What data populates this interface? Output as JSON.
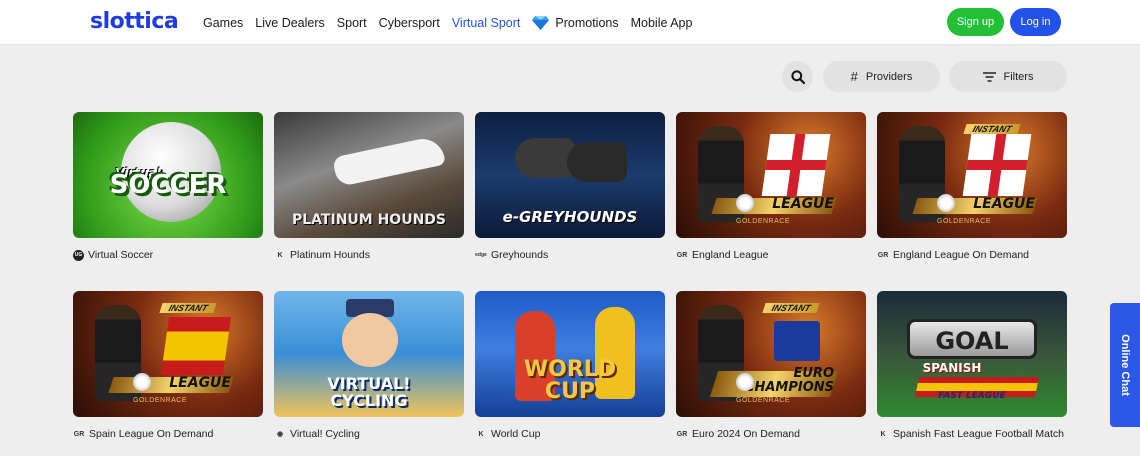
{
  "brand": {
    "logo_text": "slottica",
    "accent": "#2352e8",
    "signup_color": "#22c035"
  },
  "nav": {
    "items": [
      {
        "label": "Games"
      },
      {
        "label": "Live Dealers"
      },
      {
        "label": "Sport"
      },
      {
        "label": "Cybersport"
      },
      {
        "label": "Virtual Sport",
        "active": true
      },
      {
        "label": "Promotions",
        "icon": "diamond-icon"
      },
      {
        "label": "Mobile App"
      }
    ]
  },
  "auth": {
    "signup_label": "Sign up",
    "login_label": "Log in"
  },
  "toolbar": {
    "search_icon": "search-icon",
    "providers_label": "Providers",
    "filters_label": "Filters"
  },
  "games": [
    {
      "title": "Virtual Soccer",
      "art_text": "SOCCER",
      "art_sub": "Virtual",
      "provider_icon": "ug-provider-icon"
    },
    {
      "title": "Platinum Hounds",
      "art_text": "PLATINUM HOUNDS",
      "provider_icon": "k-provider-icon"
    },
    {
      "title": "Greyhounds",
      "art_text": "e-GREYHOUNDS",
      "provider_icon": "edge-provider-icon"
    },
    {
      "title": "England League",
      "art_text": "LEAGUE",
      "art_brand": "GOLDENRACE",
      "provider_icon": "gr-provider-icon"
    },
    {
      "title": "England League On Demand",
      "art_text": "LEAGUE",
      "art_tag": "INSTANT",
      "art_brand": "GOLDENRACE",
      "provider_icon": "gr-provider-icon"
    },
    {
      "title": "Spain League On Demand",
      "art_text": "LEAGUE",
      "art_tag": "INSTANT",
      "art_brand": "GOLDENRACE",
      "provider_icon": "gr-provider-icon"
    },
    {
      "title": "Virtual! Cycling",
      "art_text": "VIRTUAL! CYCLING",
      "provider_icon": "eye-provider-icon"
    },
    {
      "title": "World Cup",
      "art_text": "WORLD CUP",
      "provider_icon": "k-provider-icon"
    },
    {
      "title": "Euro 2024 On Demand",
      "art_text": "EURO CHAMPIONS",
      "art_tag": "INSTANT",
      "art_brand": "GOLDENRACE",
      "provider_icon": "gr-provider-icon"
    },
    {
      "title": "Spanish Fast League Football Match",
      "art_text": "GOAL",
      "art_sub": "SPANISH",
      "art_tag": "FAST LEAGUE",
      "provider_icon": "k-provider-icon"
    }
  ],
  "chat": {
    "label": "Online Chat"
  }
}
